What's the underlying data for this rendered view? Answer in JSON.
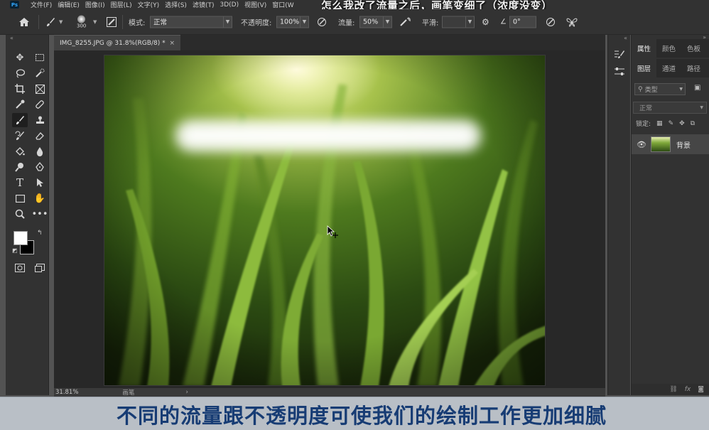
{
  "menubar": {
    "logo": "Ps",
    "items": [
      "文件(F)",
      "编辑(E)",
      "图像(I)",
      "图层(L)",
      "文字(Y)",
      "选择(S)",
      "滤镜(T)",
      "3D(D)",
      "视图(V)",
      "窗口(W"
    ]
  },
  "top_caption": "怎么我改了流量之后，画笔变细了（浓度没变）",
  "options": {
    "brush_size": "300",
    "mode_label": "模式:",
    "mode_value": "正常",
    "opacity_label": "不透明度:",
    "opacity_value": "100%",
    "flow_label": "流量:",
    "flow_value": "50%",
    "smoothing_label": "平滑:",
    "angle_value": "0°"
  },
  "document": {
    "tab_title": "IMG_8255.JPG @ 31.8%(RGB/8) *",
    "tab_close": "×",
    "zoom": "31.81%",
    "status_text": "画笔"
  },
  "right_panel": {
    "tabs_top": [
      "属性",
      "颜色",
      "色板"
    ],
    "tabs_layers": [
      "图层",
      "通道",
      "路径"
    ],
    "filter_label": "类型",
    "blend_mode": "正常",
    "lock_label": "锁定:",
    "layer_name": "背景"
  },
  "bottom_caption": "不同的流量跟不透明度可使我们的绘制工作更加细腻",
  "colors": {
    "foreground": "#ffffff",
    "background": "#000000",
    "caption_text": "#173c74",
    "caption_band": "#b9bfc6"
  }
}
